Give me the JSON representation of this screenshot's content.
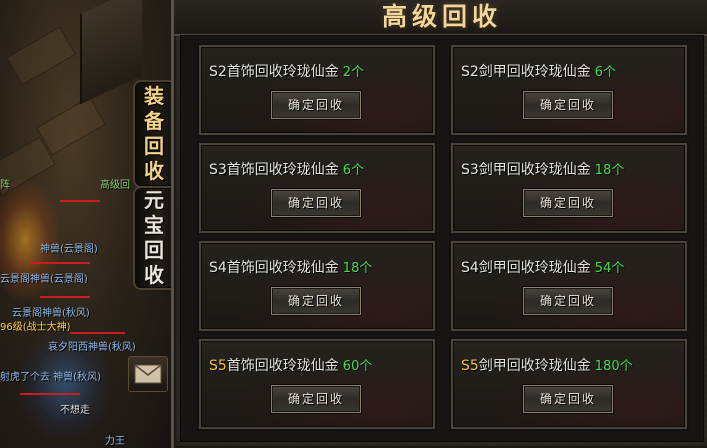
{
  "panel": {
    "title": "高级回收"
  },
  "tabs": [
    {
      "chars": [
        "装",
        "备",
        "回",
        "收"
      ]
    },
    {
      "chars": [
        "元",
        "宝",
        "回",
        "收"
      ]
    }
  ],
  "world_names": [
    {
      "text": "阵",
      "color": "#8ec86e"
    },
    {
      "text": "高级回",
      "color": "#8ec86e"
    },
    {
      "text": "神兽(云景阁)",
      "color": "#8fb8e8"
    },
    {
      "text": "云景阁神兽(云景阁)",
      "color": "#8fb8e8"
    },
    {
      "text": "云景阁神兽(秋风)",
      "color": "#8fb8e8"
    },
    {
      "text": "96级(战士大神)",
      "color": "#ffd040"
    },
    {
      "text": "哀夕阳西神兽(秋风)",
      "color": "#8fb8e8"
    },
    {
      "text": "射虎了个去 神兽(秋风)",
      "color": "#8fb8e8"
    },
    {
      "text": "不想走",
      "color": "#d8d8d8"
    },
    {
      "text": "力王",
      "color": "#8fb8e8"
    }
  ],
  "button_label": "确定回收",
  "cards": [
    {
      "tier": "S2",
      "name": "首饰回收玲珑仙金",
      "count": "2个",
      "tier_color": "#e8e4da",
      "button_label": "确定回收"
    },
    {
      "tier": "S2",
      "name": "剑甲回收玲珑仙金",
      "count": "6个",
      "tier_color": "#e8e4da",
      "button_label": "确定回收"
    },
    {
      "tier": "S3",
      "name": "首饰回收玲珑仙金",
      "count": "6个",
      "tier_color": "#e8e4da",
      "button_label": "确定回收"
    },
    {
      "tier": "S3",
      "name": "剑甲回收玲珑仙金",
      "count": "18个",
      "tier_color": "#e8e4da",
      "button_label": "确定回收"
    },
    {
      "tier": "S4",
      "name": "首饰回收玲珑仙金",
      "count": "18个",
      "tier_color": "#e8e4da",
      "button_label": "确定回收"
    },
    {
      "tier": "S4",
      "name": "剑甲回收玲珑仙金",
      "count": "54个",
      "tier_color": "#e8e4da",
      "button_label": "确定回收"
    },
    {
      "tier": "S5",
      "name": "首饰回收玲珑仙金",
      "count": "60个",
      "tier_color": "#f0c24a",
      "button_label": "确定回收"
    },
    {
      "tier": "S5",
      "name": "剑甲回收玲珑仙金",
      "count": "180个",
      "tier_color": "#f0c24a",
      "button_label": "确定回收"
    }
  ]
}
